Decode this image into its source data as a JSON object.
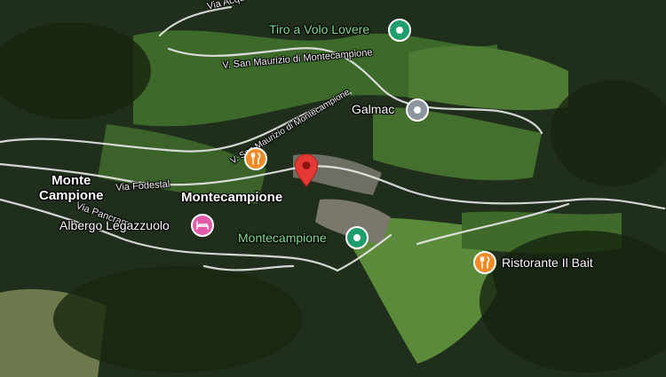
{
  "map": {
    "colors": {
      "forest": "#1f2f1b",
      "meadow": "#4f7a33",
      "road": "#e9e9e9",
      "poi_green": "#1e9e6a",
      "poi_orange": "#f08a24",
      "poi_gray": "#8a95a0",
      "poi_pink": "#e35ba8",
      "selected_pin": "#e53935"
    },
    "roads": [
      {
        "label": "Via Acqu",
        "icon": "none"
      },
      {
        "label": "V. San Maurizio di Montecampione",
        "icon": "none"
      },
      {
        "label": "V. San Maurizio di Montecampione",
        "icon": "none"
      },
      {
        "label": "Via Fodestal",
        "icon": "none"
      },
      {
        "label": "Via Pancrama",
        "icon": "none"
      }
    ],
    "places": [
      {
        "label": "Monte\nCampione"
      },
      {
        "label": "Montecampione"
      }
    ],
    "pois": [
      {
        "label": "Tiro a Volo Lovere",
        "icon": "park-icon",
        "color": "#1e9e6a"
      },
      {
        "label": "Galmac",
        "icon": "place-icon",
        "color": "#8a95a0"
      },
      {
        "label": "",
        "icon": "restaurant-icon",
        "color": "#f08a24"
      },
      {
        "label": "Albergo Legazzuolo",
        "icon": "hotel-icon",
        "color": "#e35ba8"
      },
      {
        "label": "Montecampione",
        "icon": "park-icon",
        "color": "#1e9e6a"
      },
      {
        "label": "Ristorante Il Bait",
        "icon": "restaurant-icon",
        "color": "#f08a24"
      }
    ],
    "selected_pin": {
      "icon": "map-pin-icon",
      "color": "#e53935"
    }
  }
}
